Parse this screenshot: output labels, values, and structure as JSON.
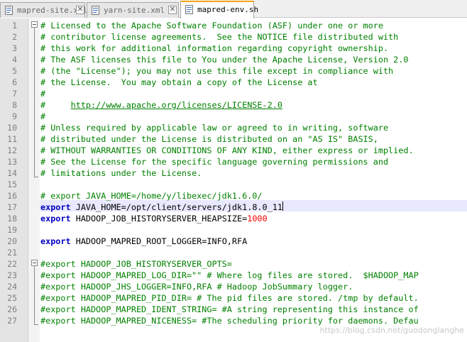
{
  "tabs": [
    {
      "label": "mapred-site.xml",
      "active": false
    },
    {
      "label": "yarn-site.xml",
      "active": false
    },
    {
      "label": "mapred-env.sh",
      "active": true
    }
  ],
  "close_glyph": "✕",
  "lines": [
    {
      "n": "1",
      "segs": [
        {
          "t": "# Licensed to the Apache Software Foundation (ASF) under one or more",
          "c": "cmt"
        }
      ]
    },
    {
      "n": "2",
      "segs": [
        {
          "t": "# contributor license agreements.  See the NOTICE file distributed with",
          "c": "cmt"
        }
      ]
    },
    {
      "n": "3",
      "segs": [
        {
          "t": "# this work for additional information regarding copyright ownership.",
          "c": "cmt"
        }
      ]
    },
    {
      "n": "4",
      "segs": [
        {
          "t": "# The ASF licenses this file to You under the Apache License, Version 2.0",
          "c": "cmt"
        }
      ]
    },
    {
      "n": "5",
      "segs": [
        {
          "t": "# (the \"License\"); you may not use this file except in compliance with",
          "c": "cmt"
        }
      ]
    },
    {
      "n": "6",
      "segs": [
        {
          "t": "# the License.  You may obtain a copy of the License at",
          "c": "cmt"
        }
      ]
    },
    {
      "n": "7",
      "segs": [
        {
          "t": "#",
          "c": "cmt"
        }
      ]
    },
    {
      "n": "8",
      "segs": [
        {
          "t": "#     ",
          "c": "cmt"
        },
        {
          "t": "http://www.apache.org/licenses/LICENSE-2.0",
          "c": "url"
        }
      ]
    },
    {
      "n": "9",
      "segs": [
        {
          "t": "#",
          "c": "cmt"
        }
      ]
    },
    {
      "n": "10",
      "segs": [
        {
          "t": "# Unless required by applicable law or agreed to in writing, software",
          "c": "cmt"
        }
      ]
    },
    {
      "n": "11",
      "segs": [
        {
          "t": "# distributed under the License is distributed on an \"AS IS\" BASIS,",
          "c": "cmt"
        }
      ]
    },
    {
      "n": "12",
      "segs": [
        {
          "t": "# WITHOUT WARRANTIES OR CONDITIONS OF ANY KIND, either express or implied.",
          "c": "cmt"
        }
      ]
    },
    {
      "n": "13",
      "segs": [
        {
          "t": "# See the License for the specific language governing permissions and",
          "c": "cmt"
        }
      ]
    },
    {
      "n": "14",
      "segs": [
        {
          "t": "# limitations under the License.",
          "c": "cmt"
        }
      ]
    },
    {
      "n": "15",
      "segs": []
    },
    {
      "n": "16",
      "segs": [
        {
          "t": "# export JAVA_HOME=/home/y/libexec/jdk1.6.0/",
          "c": "cmt"
        }
      ]
    },
    {
      "n": "17",
      "segs": [
        {
          "t": "export",
          "c": "kw"
        },
        {
          "t": " JAVA_HOME",
          "c": "op"
        },
        {
          "t": "=",
          "c": "op"
        },
        {
          "t": "/opt/client/servers/jdk1.8.0_11",
          "c": "op"
        }
      ]
    },
    {
      "n": "18",
      "segs": [
        {
          "t": "export",
          "c": "kw"
        },
        {
          "t": " HADOOP_JOB_HISTORYSERVER_HEAPSIZE=",
          "c": "op"
        },
        {
          "t": "1000",
          "c": "num"
        }
      ]
    },
    {
      "n": "19",
      "segs": []
    },
    {
      "n": "20",
      "segs": [
        {
          "t": "export",
          "c": "kw"
        },
        {
          "t": " HADOOP_MAPRED_ROOT_LOGGER=INFO,RFA",
          "c": "op"
        }
      ]
    },
    {
      "n": "21",
      "segs": []
    },
    {
      "n": "22",
      "segs": [
        {
          "t": "#export HADOOP_JOB_HISTORYSERVER_OPTS=",
          "c": "cmt"
        }
      ]
    },
    {
      "n": "23",
      "segs": [
        {
          "t": "#export HADOOP_MAPRED_LOG_DIR=\"\" # Where log files are stored.  $HADOOP_MAP",
          "c": "cmt"
        }
      ]
    },
    {
      "n": "24",
      "segs": [
        {
          "t": "#export HADOOP_JHS_LOGGER=INFO,RFA # Hadoop JobSummary logger.",
          "c": "cmt"
        }
      ]
    },
    {
      "n": "25",
      "segs": [
        {
          "t": "#export HADOOP_MAPRED_PID_DIR= # The pid files are stored. /tmp by default.",
          "c": "cmt"
        }
      ]
    },
    {
      "n": "26",
      "segs": [
        {
          "t": "#export HADOOP_MAPRED_IDENT_STRING= #A string representing this instance of",
          "c": "cmt"
        }
      ]
    },
    {
      "n": "27",
      "segs": [
        {
          "t": "#export HADOOP_MAPRED_NICENESS= #The scheduling priority for daemons. Defau",
          "c": "cmt"
        }
      ]
    }
  ],
  "watermark": "https://blog.csdn.net/guodonglanghe",
  "colors": {
    "comment": "#008000",
    "keyword": "#0000c0",
    "number": "#ff0000",
    "active_tab_accent": "#f8a61c"
  }
}
